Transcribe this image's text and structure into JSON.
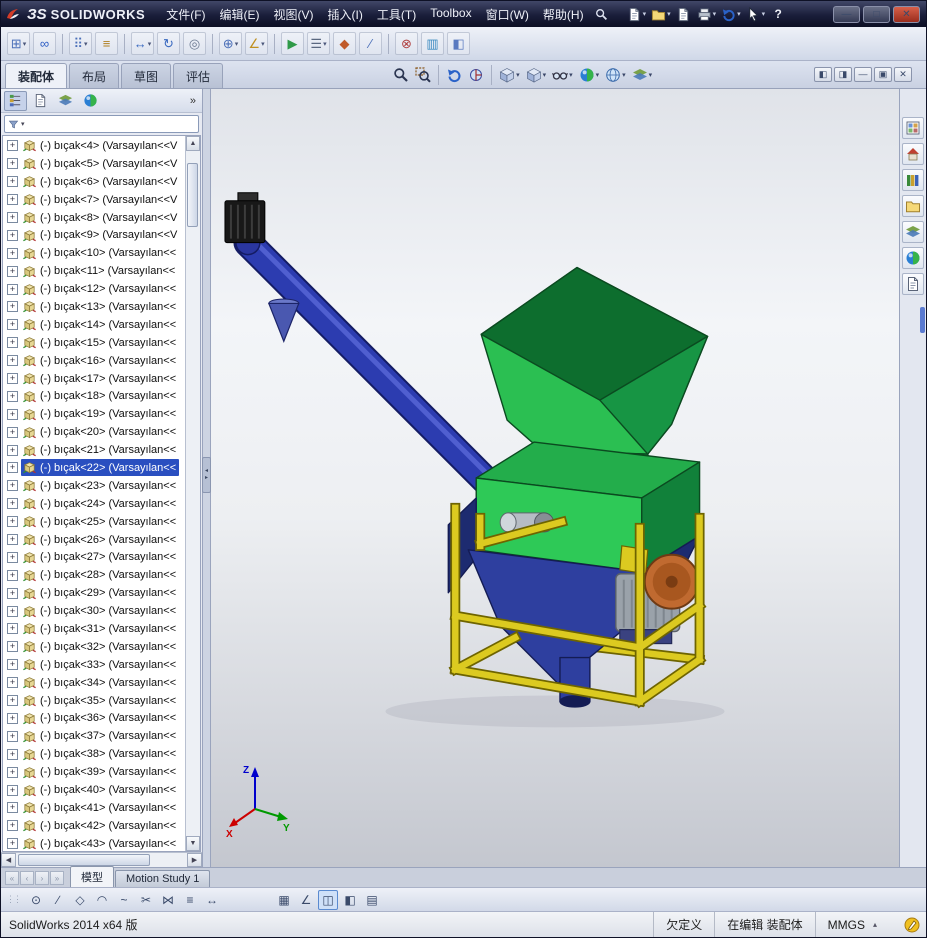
{
  "colors": {
    "selection-blue": "#2a4fc0",
    "hopper-green": "#2bbf52",
    "hopper-green-dark": "#0d6e2e",
    "hopper-green-mid": "#179544",
    "box-green": "#2ec957",
    "box-green-top": "#23ad4b",
    "box-green-side": "#11813a",
    "chute-blue": "#2e3f9f",
    "chute-blue-dark": "#1d2b70",
    "auger-blue": "#2c3cb0",
    "frame-yellow": "#dcca20",
    "frame-yellow-dark": "#6e6400",
    "motor-gray": "#9aa2aa",
    "coupling-orange": "#c06a30",
    "axis-x": "#cc0000",
    "axis-y": "#009900",
    "axis-z": "#0000cc"
  },
  "window": {
    "brand_mark": "ЗS",
    "brand_name": "SOLIDWORKS"
  },
  "menubar": {
    "items": [
      {
        "id": "file",
        "label": "文件(F)"
      },
      {
        "id": "edit",
        "label": "编辑(E)"
      },
      {
        "id": "view",
        "label": "视图(V)"
      },
      {
        "id": "insert",
        "label": "插入(I)"
      },
      {
        "id": "tools",
        "label": "工具(T)"
      },
      {
        "id": "toolbox",
        "label": "Toolbox"
      },
      {
        "id": "window",
        "label": "窗口(W)"
      },
      {
        "id": "help",
        "label": "帮助(H)"
      }
    ]
  },
  "titlebar": {
    "icons": [
      {
        "name": "new-document-button",
        "shape": "page",
        "dropdown": true
      },
      {
        "name": "open-button",
        "shape": "folder",
        "dropdown": true
      },
      {
        "name": "publish-edrawings-button",
        "shape": "page"
      },
      {
        "name": "print-button",
        "shape": "printer",
        "dropdown": true
      },
      {
        "name": "undo-button",
        "shape": "undo",
        "dropdown": true
      },
      {
        "name": "select-button",
        "shape": "pointer",
        "dropdown": true
      },
      {
        "name": "help-button",
        "glyph": "?",
        "color": "#eef1f8"
      }
    ],
    "window_buttons": [
      {
        "name": "minimize-button",
        "glyph": "—"
      },
      {
        "name": "maximize-button",
        "glyph": "□"
      },
      {
        "name": "close-button",
        "glyph": "✕",
        "variant": "close"
      }
    ]
  },
  "assembly_toolbar": {
    "icons": [
      {
        "name": "insert-components-icon",
        "glyph": "⊞",
        "color": "#4a6fb8",
        "dropdown": true
      },
      {
        "name": "mate-icon",
        "glyph": "∞",
        "color": "#2f5fc4"
      },
      {
        "sep": true
      },
      {
        "name": "linear-component-pattern-icon",
        "glyph": "⠿",
        "color": "#4a6fb8",
        "dropdown": true
      },
      {
        "name": "smart-fasteners-icon",
        "glyph": "≡",
        "color": "#b08020"
      },
      {
        "sep": true
      },
      {
        "name": "move-component-icon",
        "glyph": "↔",
        "color": "#3a6ac0",
        "dropdown": true
      },
      {
        "name": "rotate-component-icon",
        "glyph": "↻",
        "color": "#3a6ac0"
      },
      {
        "name": "show-hidden-components-icon",
        "glyph": "◎",
        "color": "#6a7890"
      },
      {
        "sep": true
      },
      {
        "name": "assembly-features-icon",
        "glyph": "⊕",
        "color": "#4a6fb8",
        "dropdown": true
      },
      {
        "name": "reference-geometry-icon",
        "glyph": "∠",
        "color": "#c09020",
        "dropdown": true
      },
      {
        "sep": true
      },
      {
        "name": "new-motion-study-icon",
        "glyph": "▶",
        "color": "#2f9a48"
      },
      {
        "name": "bill-of-materials-icon",
        "glyph": "☰",
        "color": "#5a6880",
        "dropdown": true
      },
      {
        "name": "exploded-view-icon",
        "glyph": "◆",
        "color": "#c05a2a"
      },
      {
        "name": "explode-line-sketch-icon",
        "glyph": "∕",
        "color": "#4a6fb8"
      },
      {
        "sep": true
      },
      {
        "name": "interference-detection-icon",
        "glyph": "⊗",
        "color": "#b04040"
      },
      {
        "name": "assembly-visualization-icon",
        "glyph": "▥",
        "color": "#3a8ac0"
      },
      {
        "name": "instant3d-icon",
        "glyph": "◧",
        "color": "#5a7ac0"
      }
    ]
  },
  "command_tabs": {
    "items": [
      {
        "id": "assembly",
        "label": "装配体",
        "active": true
      },
      {
        "id": "layout",
        "label": "布局"
      },
      {
        "id": "sketch",
        "label": "草图"
      },
      {
        "id": "evaluate",
        "label": "评估"
      }
    ]
  },
  "heads_up": {
    "icons": [
      {
        "name": "zoom-to-fit-icon",
        "shape": "magnifier"
      },
      {
        "name": "zoom-to-area-icon",
        "shape": "magnifier_area"
      },
      {
        "sep": true
      },
      {
        "name": "previous-view-icon",
        "shape": "undo"
      },
      {
        "name": "section-view-icon",
        "shape": "section"
      },
      {
        "sep": true
      },
      {
        "name": "view-orientation-icon",
        "shape": "cube",
        "dropdown": true
      },
      {
        "name": "display-style-icon",
        "shape": "cube",
        "dropdown": true
      },
      {
        "name": "hide-show-items-icon",
        "shape": "glasses",
        "dropdown": true
      },
      {
        "name": "edit-appearance-icon",
        "shape": "ball",
        "dropdown": true
      },
      {
        "name": "apply-scene-icon",
        "shape": "globe",
        "dropdown": true
      },
      {
        "name": "view-settings-icon",
        "shape": "layers",
        "dropdown": true
      }
    ]
  },
  "document_window_buttons": [
    {
      "name": "pane-left-icon",
      "glyph": "◧"
    },
    {
      "name": "pane-right-icon",
      "glyph": "◨"
    },
    {
      "name": "minimize-document-button",
      "glyph": "—"
    },
    {
      "name": "restore-document-button",
      "glyph": "▣"
    },
    {
      "name": "close-document-button",
      "glyph": "✕"
    }
  ],
  "feature_manager": {
    "overflow": "»",
    "tabs": [
      {
        "name": "featuremanager-design-tree-tab",
        "shape": "tree",
        "active": true
      },
      {
        "name": "propertymanager-tab",
        "shape": "page"
      },
      {
        "name": "configurationmanager-tab",
        "shape": "layers"
      },
      {
        "name": "appearances-tab",
        "shape": "ball"
      }
    ]
  },
  "tree": {
    "selected_index": 18,
    "items": [
      "(-) bıçak<4> (Varsayılan<<V",
      "(-) bıçak<5> (Varsayılan<<V",
      "(-) bıçak<6> (Varsayılan<<V",
      "(-) bıçak<7> (Varsayılan<<V",
      "(-) bıçak<8> (Varsayılan<<V",
      "(-) bıçak<9> (Varsayılan<<V",
      "(-) bıçak<10> (Varsayılan<<",
      "(-) bıçak<11> (Varsayılan<<",
      "(-) bıçak<12> (Varsayılan<<",
      "(-) bıçak<13> (Varsayılan<<",
      "(-) bıçak<14> (Varsayılan<<",
      "(-) bıçak<15> (Varsayılan<<",
      "(-) bıçak<16> (Varsayılan<<",
      "(-) bıçak<17> (Varsayılan<<",
      "(-) bıçak<18> (Varsayılan<<",
      "(-) bıçak<19> (Varsayılan<<",
      "(-) bıçak<20> (Varsayılan<<",
      "(-) bıçak<21> (Varsayılan<<",
      "(-) bıçak<22> (Varsayılan<<",
      "(-) bıçak<23> (Varsayılan<<",
      "(-) bıçak<24> (Varsayılan<<",
      "(-) bıçak<25> (Varsayılan<<",
      "(-) bıçak<26> (Varsayılan<<",
      "(-) bıçak<27> (Varsayılan<<",
      "(-) bıçak<28> (Varsayılan<<",
      "(-) bıçak<29> (Varsayılan<<",
      "(-) bıçak<30> (Varsayılan<<",
      "(-) bıçak<31> (Varsayılan<<",
      "(-) bıçak<32> (Varsayılan<<",
      "(-) bıçak<33> (Varsayılan<<",
      "(-) bıçak<34> (Varsayılan<<",
      "(-) bıçak<35> (Varsayılan<<",
      "(-) bıçak<36> (Varsayılan<<",
      "(-) bıçak<37> (Varsayılan<<",
      "(-) bıçak<38> (Varsayılan<<",
      "(-) bıçak<39> (Varsayılan<<",
      "(-) bıçak<40> (Varsayılan<<",
      "(-) bıçak<41> (Varsayılan<<",
      "(-) bıçak<42> (Varsayılan<<",
      "(-) bıçak<43> (Varsayılan<<"
    ]
  },
  "task_pane": {
    "icons": [
      {
        "name": "solidworks-resources-tab",
        "shape": "palette"
      },
      {
        "name": "design-library-tab",
        "shape": "house"
      },
      {
        "name": "file-explorer-tab",
        "shape": "books"
      },
      {
        "name": "view-palette-tab",
        "shape": "folder"
      },
      {
        "name": "appearances-scenes-tab",
        "shape": "layers"
      },
      {
        "name": "custom-properties-tab",
        "shape": "ball"
      },
      {
        "name": "document-properties-tab",
        "shape": "page"
      }
    ]
  },
  "viewport": {
    "triad": {
      "x": "X",
      "y": "Y",
      "z": "Z"
    }
  },
  "bottom_tabs": {
    "nav": [
      "«",
      "‹",
      "›",
      "»"
    ],
    "items": [
      {
        "id": "model",
        "label": "模型",
        "active": true
      },
      {
        "id": "motion-study-1",
        "label": "Motion Study 1"
      }
    ]
  },
  "sketch_toolbar": {
    "left": [
      {
        "name": "circle-tool-icon",
        "glyph": "⊙"
      },
      {
        "name": "line-tool-icon",
        "glyph": "∕"
      },
      {
        "name": "polygon-tool-icon",
        "glyph": "◇"
      },
      {
        "name": "arc-tool-icon",
        "glyph": "◠"
      },
      {
        "name": "spline-tool-icon",
        "glyph": "~"
      },
      {
        "name": "trim-entities-icon",
        "glyph": "✂"
      },
      {
        "name": "mirror-entities-icon",
        "glyph": "⋈"
      },
      {
        "name": "offset-entities-icon",
        "glyph": "≡"
      },
      {
        "name": "smart-dimension-icon",
        "glyph": "↔"
      }
    ],
    "right": [
      {
        "name": "grid-settings-icon",
        "glyph": "▦"
      },
      {
        "name": "angle-snap-icon",
        "glyph": "∠"
      },
      {
        "name": "isometric-view-icon",
        "glyph": "◫",
        "active": true
      },
      {
        "name": "section-display-icon",
        "glyph": "◧"
      },
      {
        "name": "sheet-format-icon",
        "glyph": "▤"
      }
    ]
  },
  "status": {
    "left": "SolidWorks 2014 x64 版",
    "definition": "欠定义",
    "editing": "在编辑 装配体",
    "units": "MMGS",
    "units_arrow": "▴"
  }
}
